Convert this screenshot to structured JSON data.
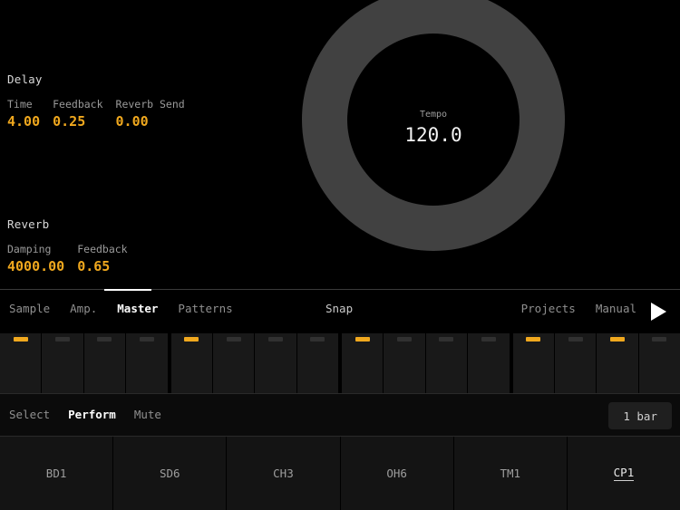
{
  "effects": [
    {
      "name": "Delay",
      "params": [
        {
          "label": "Time",
          "value": "4.00"
        },
        {
          "label": "Feedback",
          "value": "0.25"
        },
        {
          "label": "Reverb Send",
          "value": "0.00"
        }
      ]
    },
    {
      "name": "Reverb",
      "params": [
        {
          "label": "Damping",
          "value": "4000.00"
        },
        {
          "label": "Feedback",
          "value": "0.65"
        }
      ]
    }
  ],
  "knob": {
    "label": "Tempo",
    "value": "120.0"
  },
  "navbar": {
    "tabs": [
      {
        "label": "Sample",
        "active": false
      },
      {
        "label": "Amp.",
        "active": false
      },
      {
        "label": "Master",
        "active": true
      },
      {
        "label": "Patterns",
        "active": false
      }
    ],
    "snap_label": "Snap",
    "right_items": [
      {
        "label": "Projects"
      },
      {
        "label": "Manual"
      }
    ],
    "play_icon": "play-icon"
  },
  "sequencer": {
    "steps": [
      {
        "index": 1,
        "on": true
      },
      {
        "index": 2,
        "on": false
      },
      {
        "index": 3,
        "on": false
      },
      {
        "index": 4,
        "on": false
      },
      {
        "index": 5,
        "on": true
      },
      {
        "index": 6,
        "on": false
      },
      {
        "index": 7,
        "on": false
      },
      {
        "index": 8,
        "on": false
      },
      {
        "index": 9,
        "on": true
      },
      {
        "index": 10,
        "on": false
      },
      {
        "index": 11,
        "on": false
      },
      {
        "index": 12,
        "on": false
      },
      {
        "index": 13,
        "on": true
      },
      {
        "index": 14,
        "on": false
      },
      {
        "index": 15,
        "on": true
      },
      {
        "index": 16,
        "on": false
      }
    ]
  },
  "modebar": {
    "modes": [
      {
        "label": "Select",
        "active": false
      },
      {
        "label": "Perform",
        "active": true
      },
      {
        "label": "Mute",
        "active": false
      }
    ],
    "length_label": "1 bar"
  },
  "pads": [
    {
      "label": "BD1",
      "selected": false
    },
    {
      "label": "SD6",
      "selected": false
    },
    {
      "label": "CH3",
      "selected": false
    },
    {
      "label": "OH6",
      "selected": false
    },
    {
      "label": "TM1",
      "selected": false
    },
    {
      "label": "CP1",
      "selected": true
    }
  ],
  "colors": {
    "accent": "#f0a81e",
    "background": "#000000",
    "knob_ring": "#414141",
    "step_off": "#313131",
    "text_dim": "#8f8f8f",
    "text_bright": "#ffffff"
  }
}
